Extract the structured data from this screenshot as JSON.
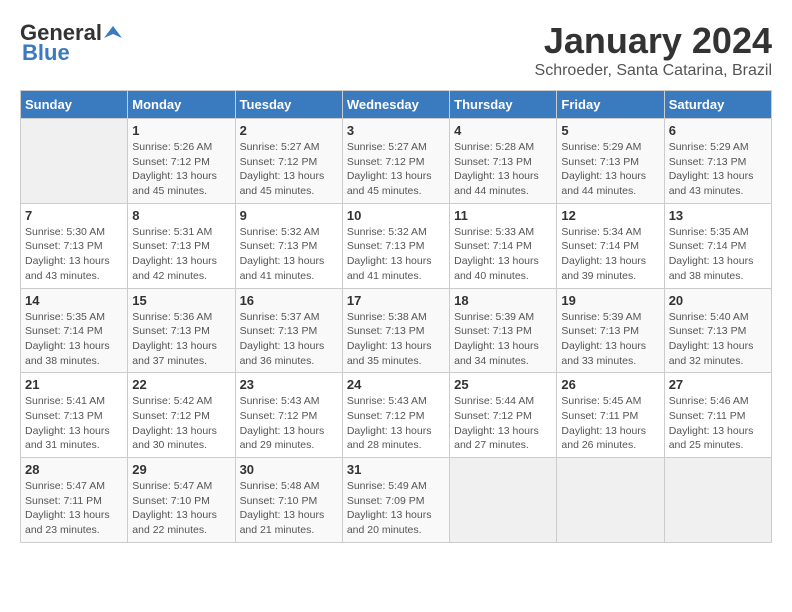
{
  "header": {
    "logo_general": "General",
    "logo_blue": "Blue",
    "month_title": "January 2024",
    "location": "Schroeder, Santa Catarina, Brazil"
  },
  "days_of_week": [
    "Sunday",
    "Monday",
    "Tuesday",
    "Wednesday",
    "Thursday",
    "Friday",
    "Saturday"
  ],
  "weeks": [
    [
      {
        "day": "",
        "info": ""
      },
      {
        "day": "1",
        "info": "Sunrise: 5:26 AM\nSunset: 7:12 PM\nDaylight: 13 hours\nand 45 minutes."
      },
      {
        "day": "2",
        "info": "Sunrise: 5:27 AM\nSunset: 7:12 PM\nDaylight: 13 hours\nand 45 minutes."
      },
      {
        "day": "3",
        "info": "Sunrise: 5:27 AM\nSunset: 7:12 PM\nDaylight: 13 hours\nand 45 minutes."
      },
      {
        "day": "4",
        "info": "Sunrise: 5:28 AM\nSunset: 7:13 PM\nDaylight: 13 hours\nand 44 minutes."
      },
      {
        "day": "5",
        "info": "Sunrise: 5:29 AM\nSunset: 7:13 PM\nDaylight: 13 hours\nand 44 minutes."
      },
      {
        "day": "6",
        "info": "Sunrise: 5:29 AM\nSunset: 7:13 PM\nDaylight: 13 hours\nand 43 minutes."
      }
    ],
    [
      {
        "day": "7",
        "info": "Sunrise: 5:30 AM\nSunset: 7:13 PM\nDaylight: 13 hours\nand 43 minutes."
      },
      {
        "day": "8",
        "info": "Sunrise: 5:31 AM\nSunset: 7:13 PM\nDaylight: 13 hours\nand 42 minutes."
      },
      {
        "day": "9",
        "info": "Sunrise: 5:32 AM\nSunset: 7:13 PM\nDaylight: 13 hours\nand 41 minutes."
      },
      {
        "day": "10",
        "info": "Sunrise: 5:32 AM\nSunset: 7:13 PM\nDaylight: 13 hours\nand 41 minutes."
      },
      {
        "day": "11",
        "info": "Sunrise: 5:33 AM\nSunset: 7:14 PM\nDaylight: 13 hours\nand 40 minutes."
      },
      {
        "day": "12",
        "info": "Sunrise: 5:34 AM\nSunset: 7:14 PM\nDaylight: 13 hours\nand 39 minutes."
      },
      {
        "day": "13",
        "info": "Sunrise: 5:35 AM\nSunset: 7:14 PM\nDaylight: 13 hours\nand 38 minutes."
      }
    ],
    [
      {
        "day": "14",
        "info": "Sunrise: 5:35 AM\nSunset: 7:14 PM\nDaylight: 13 hours\nand 38 minutes."
      },
      {
        "day": "15",
        "info": "Sunrise: 5:36 AM\nSunset: 7:13 PM\nDaylight: 13 hours\nand 37 minutes."
      },
      {
        "day": "16",
        "info": "Sunrise: 5:37 AM\nSunset: 7:13 PM\nDaylight: 13 hours\nand 36 minutes."
      },
      {
        "day": "17",
        "info": "Sunrise: 5:38 AM\nSunset: 7:13 PM\nDaylight: 13 hours\nand 35 minutes."
      },
      {
        "day": "18",
        "info": "Sunrise: 5:39 AM\nSunset: 7:13 PM\nDaylight: 13 hours\nand 34 minutes."
      },
      {
        "day": "19",
        "info": "Sunrise: 5:39 AM\nSunset: 7:13 PM\nDaylight: 13 hours\nand 33 minutes."
      },
      {
        "day": "20",
        "info": "Sunrise: 5:40 AM\nSunset: 7:13 PM\nDaylight: 13 hours\nand 32 minutes."
      }
    ],
    [
      {
        "day": "21",
        "info": "Sunrise: 5:41 AM\nSunset: 7:13 PM\nDaylight: 13 hours\nand 31 minutes."
      },
      {
        "day": "22",
        "info": "Sunrise: 5:42 AM\nSunset: 7:12 PM\nDaylight: 13 hours\nand 30 minutes."
      },
      {
        "day": "23",
        "info": "Sunrise: 5:43 AM\nSunset: 7:12 PM\nDaylight: 13 hours\nand 29 minutes."
      },
      {
        "day": "24",
        "info": "Sunrise: 5:43 AM\nSunset: 7:12 PM\nDaylight: 13 hours\nand 28 minutes."
      },
      {
        "day": "25",
        "info": "Sunrise: 5:44 AM\nSunset: 7:12 PM\nDaylight: 13 hours\nand 27 minutes."
      },
      {
        "day": "26",
        "info": "Sunrise: 5:45 AM\nSunset: 7:11 PM\nDaylight: 13 hours\nand 26 minutes."
      },
      {
        "day": "27",
        "info": "Sunrise: 5:46 AM\nSunset: 7:11 PM\nDaylight: 13 hours\nand 25 minutes."
      }
    ],
    [
      {
        "day": "28",
        "info": "Sunrise: 5:47 AM\nSunset: 7:11 PM\nDaylight: 13 hours\nand 23 minutes."
      },
      {
        "day": "29",
        "info": "Sunrise: 5:47 AM\nSunset: 7:10 PM\nDaylight: 13 hours\nand 22 minutes."
      },
      {
        "day": "30",
        "info": "Sunrise: 5:48 AM\nSunset: 7:10 PM\nDaylight: 13 hours\nand 21 minutes."
      },
      {
        "day": "31",
        "info": "Sunrise: 5:49 AM\nSunset: 7:09 PM\nDaylight: 13 hours\nand 20 minutes."
      },
      {
        "day": "",
        "info": ""
      },
      {
        "day": "",
        "info": ""
      },
      {
        "day": "",
        "info": ""
      }
    ]
  ]
}
